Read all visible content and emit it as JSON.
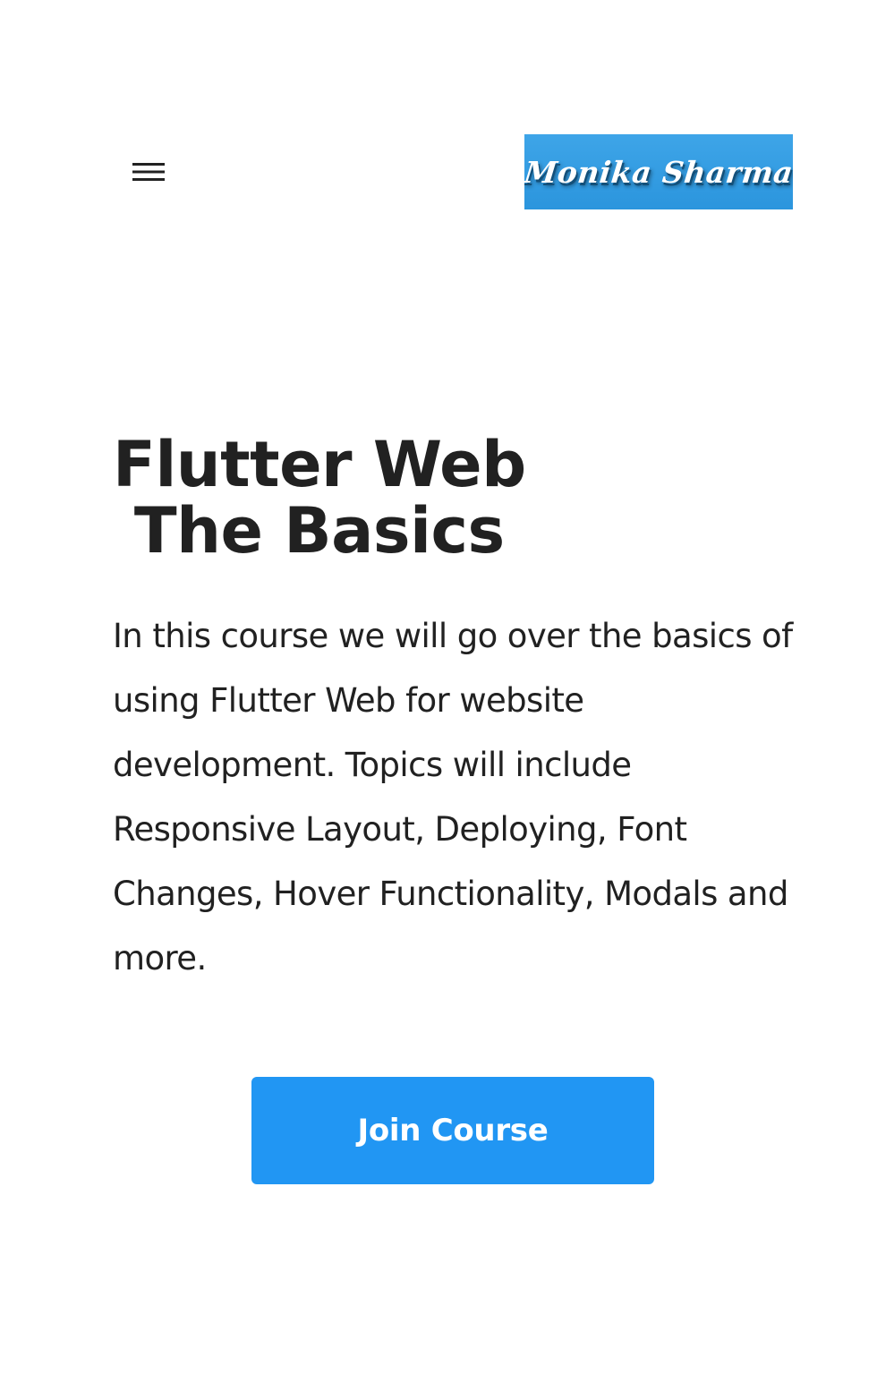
{
  "header": {
    "menu_icon": "hamburger-menu-icon",
    "logo_text": "Monika Sharma"
  },
  "hero": {
    "title_line1": "Flutter Web",
    "title_line2": " The Basics",
    "description": "In this course we will go over the basics of using Flutter Web for website development. Topics will include Responsive Layout, Deploying, Font Changes, Hover Functionality, Modals and more.",
    "cta_label": "Join Course"
  },
  "colors": {
    "primary": "#2196f3",
    "logo_background": "#3ea5e8",
    "text": "#212121",
    "background": "#ffffff"
  }
}
